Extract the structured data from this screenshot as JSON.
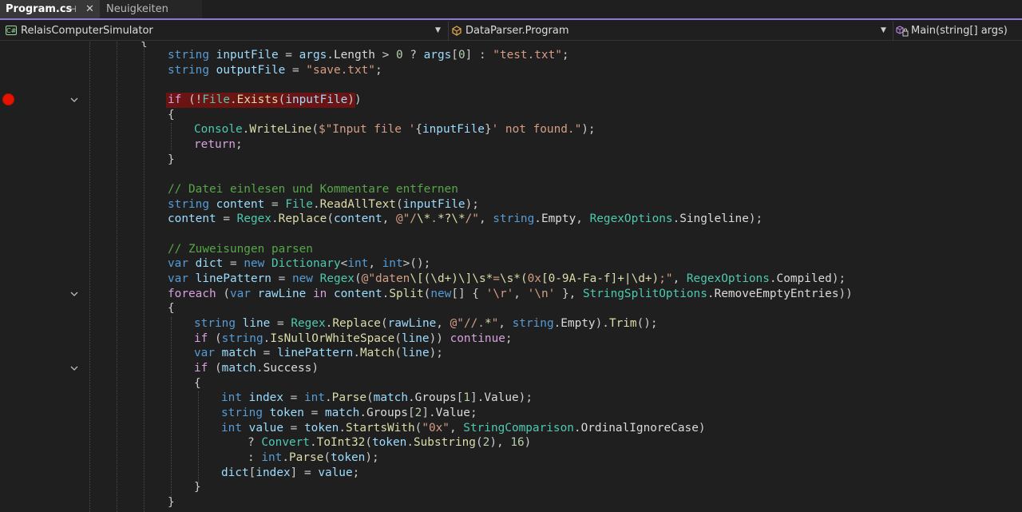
{
  "tabs": [
    {
      "label": "Program.cs",
      "active": true
    },
    {
      "label": "Neuigkeiten",
      "active": false
    }
  ],
  "tab_icons": {
    "pin": "pin-icon",
    "close": "close-icon"
  },
  "navbar": {
    "project": "RelaisComputerSimulator",
    "class": "DataParser.Program",
    "member": "Main(string[] args)"
  },
  "colors": {
    "accent": "#8f77d9",
    "breakpoint": "#e51400",
    "breakpoint_line": "#6b1414",
    "keyword": "#569cd6",
    "control": "#d8a0df",
    "type": "#4ec9b0",
    "method": "#dcdcaa",
    "string": "#d69d85",
    "comment": "#57a64a"
  },
  "code": {
    "l00": "{",
    "l01": "string inputFile = args.Length > 0 ? args[0] : \"test.txt\";",
    "l02": "string outputFile = \"save.txt\";",
    "l03": "",
    "l04": "if (!File.Exists(inputFile))",
    "l05": "{",
    "l06": "Console.WriteLine($\"Input file '{inputFile}' not found.\");",
    "l07": "return;",
    "l08": "}",
    "l09": "",
    "l10": "// Datei einlesen und Kommentare entfernen",
    "l11": "string content = File.ReadAllText(inputFile);",
    "l12": "content = Regex.Replace(content, @\"/\\*.*?\\*/\", string.Empty, RegexOptions.Singleline);",
    "l13": "",
    "l14": "// Zuweisungen parsen",
    "l15": "var dict = new Dictionary<int, int>();",
    "l16": "var linePattern = new Regex(@\"daten\\[(\\d+)\\]\\s*=\\s*(0x[0-9A-Fa-f]+|\\d+);\", RegexOptions.Compiled);",
    "l17": "foreach (var rawLine in content.Split(new[] { '\\r', '\\n' }, StringSplitOptions.RemoveEmptyEntries))",
    "l18": "{",
    "l19": "string line = Regex.Replace(rawLine, @\"//.*\", string.Empty).Trim();",
    "l20": "if (string.IsNullOrWhiteSpace(line)) continue;",
    "l21": "var match = linePattern.Match(line);",
    "l22": "if (match.Success)",
    "l23": "{",
    "l24": "int index = int.Parse(match.Groups[1].Value);",
    "l25": "string token = match.Groups[2].Value;",
    "l26": "int value = token.StartsWith(\"0x\", StringComparison.OrdinalIgnoreCase)",
    "l27": "? Convert.ToInt32(token.Substring(2), 16)",
    "l28": ": int.Parse(token);",
    "l29": "dict[index] = value;",
    "l30": "}",
    "l31": "}"
  }
}
